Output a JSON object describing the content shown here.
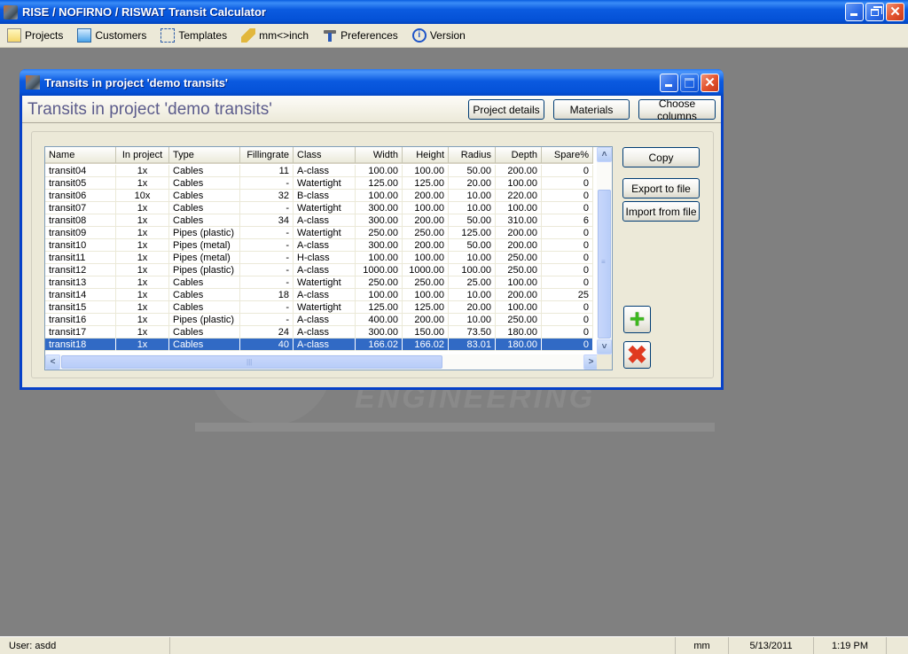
{
  "app": {
    "title": "RISE / NOFIRNO / RISWAT Transit Calculator"
  },
  "menu": [
    {
      "label": "Projects",
      "icon": "projects-icon"
    },
    {
      "label": "Customers",
      "icon": "customers-icon"
    },
    {
      "label": "Templates",
      "icon": "templates-icon"
    },
    {
      "label": "mm<>inch",
      "icon": "ruler-icon"
    },
    {
      "label": "Preferences",
      "icon": "hammer-icon"
    },
    {
      "label": "Version",
      "icon": "info-icon"
    }
  ],
  "child_window": {
    "title": "Transits in project 'demo transits'",
    "heading": "Transits in project 'demo transits'",
    "buttons": {
      "project_details": "Project details",
      "materials": "Materials",
      "choose_columns": "Choose columns",
      "copy": "Copy",
      "export": "Export to file",
      "import": "Import from file"
    },
    "icon_buttons": {
      "add": "+",
      "delete": "✖"
    }
  },
  "table": {
    "columns": [
      "Name",
      "In project",
      "Type",
      "Fillingrate",
      "Class",
      "Width",
      "Height",
      "Radius",
      "Depth",
      "Spare%"
    ],
    "rows": [
      [
        "transit04",
        "1x",
        "Cables",
        "11",
        "A-class",
        "100.00",
        "100.00",
        "50.00",
        "200.00",
        "0"
      ],
      [
        "transit05",
        "1x",
        "Cables",
        "-",
        "Watertight",
        "125.00",
        "125.00",
        "20.00",
        "100.00",
        "0"
      ],
      [
        "transit06",
        "10x",
        "Cables",
        "32",
        "B-class",
        "100.00",
        "200.00",
        "10.00",
        "220.00",
        "0"
      ],
      [
        "transit07",
        "1x",
        "Cables",
        "-",
        "Watertight",
        "300.00",
        "100.00",
        "10.00",
        "100.00",
        "0"
      ],
      [
        "transit08",
        "1x",
        "Cables",
        "34",
        "A-class",
        "300.00",
        "200.00",
        "50.00",
        "310.00",
        "6"
      ],
      [
        "transit09",
        "1x",
        "Pipes (plastic)",
        "-",
        "Watertight",
        "250.00",
        "250.00",
        "125.00",
        "200.00",
        "0"
      ],
      [
        "transit10",
        "1x",
        "Pipes (metal)",
        "-",
        "A-class",
        "300.00",
        "200.00",
        "50.00",
        "200.00",
        "0"
      ],
      [
        "transit11",
        "1x",
        "Pipes (metal)",
        "-",
        "H-class",
        "100.00",
        "100.00",
        "10.00",
        "250.00",
        "0"
      ],
      [
        "transit12",
        "1x",
        "Pipes (plastic)",
        "-",
        "A-class",
        "1000.00",
        "1000.00",
        "100.00",
        "250.00",
        "0"
      ],
      [
        "transit13",
        "1x",
        "Cables",
        "-",
        "Watertight",
        "250.00",
        "250.00",
        "25.00",
        "100.00",
        "0"
      ],
      [
        "transit14",
        "1x",
        "Cables",
        "18",
        "A-class",
        "100.00",
        "100.00",
        "10.00",
        "200.00",
        "25"
      ],
      [
        "transit15",
        "1x",
        "Cables",
        "-",
        "Watertight",
        "125.00",
        "125.00",
        "20.00",
        "100.00",
        "0"
      ],
      [
        "transit16",
        "1x",
        "Pipes (plastic)",
        "-",
        "A-class",
        "400.00",
        "200.00",
        "10.00",
        "250.00",
        "0"
      ],
      [
        "transit17",
        "1x",
        "Cables",
        "24",
        "A-class",
        "300.00",
        "150.00",
        "73.50",
        "180.00",
        "0"
      ],
      [
        "transit18",
        "1x",
        "Cables",
        "40",
        "A-class",
        "166.02",
        "166.02",
        "83.01",
        "180.00",
        "0"
      ]
    ],
    "selected_row": "transit18"
  },
  "scrollbar_glyphs": {
    "up": "˄",
    "down": "˅",
    "left": "<",
    "right": ">",
    "grip_v": "≡",
    "grip_h": "|||"
  },
  "watermark": {
    "text": "ENGINEERING"
  },
  "statusbar": {
    "user": "User: asdd",
    "unit": "mm",
    "date": "5/13/2011",
    "time": "1:19 PM"
  },
  "colors": {
    "titlebar": "#0551d6",
    "selection": "#316ac5",
    "desktop": "#808080",
    "heading": "#5c5c8c"
  }
}
